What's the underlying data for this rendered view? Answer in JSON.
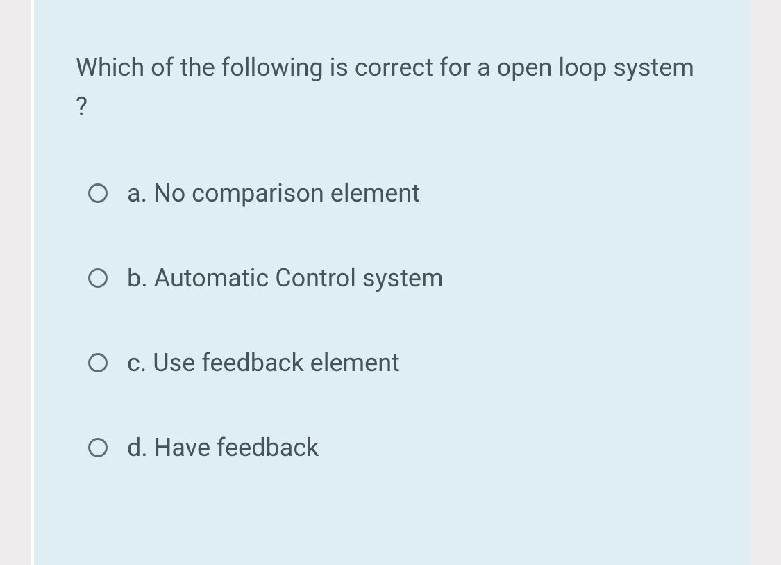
{
  "question": {
    "text": "Which of the following is correct for a open loop system ?",
    "options": [
      {
        "letter": "a.",
        "text": "No comparison element"
      },
      {
        "letter": "b.",
        "text": "Automatic Control system"
      },
      {
        "letter": "c.",
        "text": "Use feedback element"
      },
      {
        "letter": "d.",
        "text": "Have feedback"
      }
    ]
  }
}
